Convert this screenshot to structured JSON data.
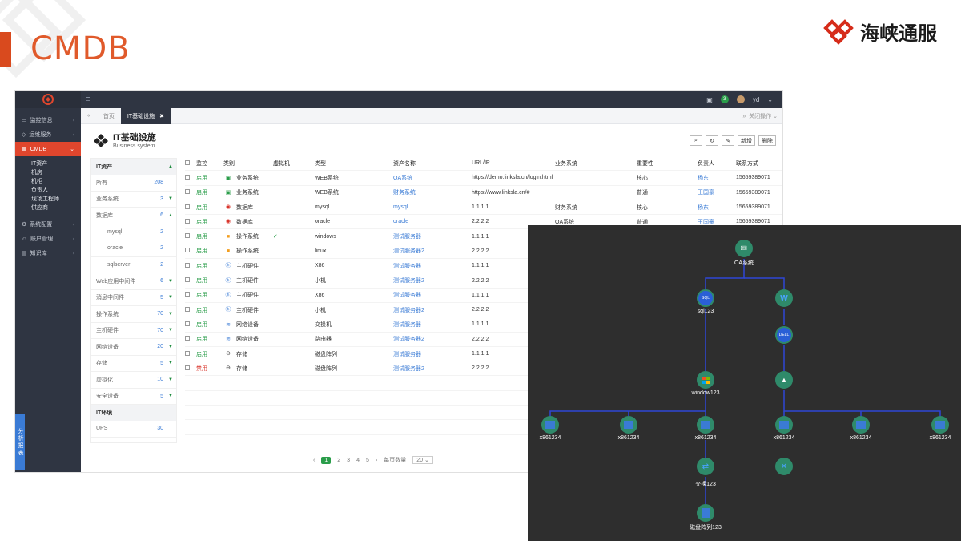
{
  "slide": {
    "title": "CMDB",
    "brand": "海峡通服",
    "colors": {
      "accent": "#e05a2b",
      "topo_bg": "#2e2e2e",
      "node": "#2f8a6a",
      "link": "#2f46d6"
    }
  },
  "app": {
    "topbar": {
      "user": "yd",
      "badge": "3"
    },
    "sidebar": {
      "items": [
        {
          "label": "监控信息",
          "icon": "monitor-icon"
        },
        {
          "label": "运维服务",
          "icon": "service-icon"
        },
        {
          "label": "CMDB",
          "icon": "grid-icon",
          "active": true
        },
        {
          "label": "系统配置",
          "icon": "gear-icon"
        },
        {
          "label": "账户管理",
          "icon": "user-icon"
        },
        {
          "label": "知识库",
          "icon": "book-icon"
        }
      ],
      "cmdb_sub": [
        "IT资产",
        "机房",
        "机柜",
        "负责人",
        "现场工程师",
        "供应商"
      ],
      "report": "分析报表"
    },
    "tabs": {
      "home": "首页",
      "current": "IT基础设施",
      "close_ops": "关闭操作"
    },
    "page": {
      "title": "IT基础设施",
      "subtitle": "Business system"
    },
    "toolbar": {
      "new": "新增",
      "delete": "删除"
    },
    "categories": {
      "head": "IT资产",
      "rows": [
        {
          "label": "所有",
          "count": "208"
        },
        {
          "label": "业务系统",
          "count": "3"
        },
        {
          "label": "数据库",
          "count": "6"
        },
        {
          "label": "mysql",
          "count": "2"
        },
        {
          "label": "oracle",
          "count": "2"
        },
        {
          "label": "sqlserver",
          "count": "2"
        },
        {
          "label": "Web应用中间件",
          "count": "6"
        },
        {
          "label": "消息中间件",
          "count": "5"
        },
        {
          "label": "操作系统",
          "count": "70"
        },
        {
          "label": "主机硬件",
          "count": "70"
        },
        {
          "label": "网络设备",
          "count": "20"
        },
        {
          "label": "存储",
          "count": "5"
        },
        {
          "label": "虚拟化",
          "count": "10"
        },
        {
          "label": "安全设备",
          "count": "5"
        }
      ],
      "env_head": "IT环境",
      "env_rows": [
        {
          "label": "UPS",
          "count": "30"
        }
      ]
    },
    "columns": [
      "监控",
      "类别",
      "虚拟机",
      "类型",
      "资产名称",
      "URL/IP",
      "业务系统",
      "重要性",
      "负责人",
      "联系方式"
    ],
    "rows": [
      {
        "status": "启用",
        "cat": "业务系统",
        "vm": "",
        "type": "WEB系统",
        "name": "OA系统",
        "url": "https://demo.linksla.cn/login.html",
        "biz": "",
        "imp": "核心",
        "owner": "杨东",
        "phone": "15659389071"
      },
      {
        "status": "启用",
        "cat": "业务系统",
        "vm": "",
        "type": "WEB系统",
        "name": "财务系统",
        "url": "https://www.linksla.cn/#",
        "biz": "",
        "imp": "普通",
        "owner": "王国豪",
        "phone": "15659389071"
      },
      {
        "status": "启用",
        "cat": "数据库",
        "vm": "",
        "type": "mysql",
        "name": "mysql",
        "url": "1.1.1.1",
        "biz": "财务系统",
        "imp": "核心",
        "owner": "杨东",
        "phone": "15659389071"
      },
      {
        "status": "启用",
        "cat": "数据库",
        "vm": "",
        "type": "oracle",
        "name": "oracle",
        "url": "2.2.2.2",
        "biz": "OA系统",
        "imp": "普通",
        "owner": "王国豪",
        "phone": "15659389071"
      },
      {
        "status": "启用",
        "cat": "操作系统",
        "vm": "✓",
        "type": "windows",
        "name": "测试服务器",
        "url": "1.1.1.1",
        "biz": "",
        "imp": "",
        "owner": "",
        "phone": ""
      },
      {
        "status": "启用",
        "cat": "操作系统",
        "vm": "",
        "type": "linux",
        "name": "测试服务器2",
        "url": "2.2.2.2",
        "biz": "",
        "imp": "",
        "owner": "",
        "phone": ""
      },
      {
        "status": "启用",
        "cat": "主机硬件",
        "vm": "",
        "type": "X86",
        "name": "测试服务器",
        "url": "1.1.1.1",
        "biz": "",
        "imp": "",
        "owner": "",
        "phone": ""
      },
      {
        "status": "启用",
        "cat": "主机硬件",
        "vm": "",
        "type": "小机",
        "name": "测试服务器2",
        "url": "2.2.2.2",
        "biz": "",
        "imp": "",
        "owner": "",
        "phone": ""
      },
      {
        "status": "启用",
        "cat": "主机硬件",
        "vm": "",
        "type": "X86",
        "name": "测试服务器",
        "url": "1.1.1.1",
        "biz": "",
        "imp": "",
        "owner": "",
        "phone": ""
      },
      {
        "status": "启用",
        "cat": "主机硬件",
        "vm": "",
        "type": "小机",
        "name": "测试服务器2",
        "url": "2.2.2.2",
        "biz": "",
        "imp": "",
        "owner": "",
        "phone": ""
      },
      {
        "status": "启用",
        "cat": "网络设备",
        "vm": "",
        "type": "交换机",
        "name": "测试服务器",
        "url": "1.1.1.1",
        "biz": "",
        "imp": "",
        "owner": "",
        "phone": ""
      },
      {
        "status": "启用",
        "cat": "网络设备",
        "vm": "",
        "type": "路由器",
        "name": "测试服务器2",
        "url": "2.2.2.2",
        "biz": "",
        "imp": "",
        "owner": "",
        "phone": ""
      },
      {
        "status": "启用",
        "cat": "存储",
        "vm": "",
        "type": "磁盘阵列",
        "name": "测试服务器",
        "url": "1.1.1.1",
        "biz": "",
        "imp": "",
        "owner": "",
        "phone": ""
      },
      {
        "status": "禁用",
        "cat": "存储",
        "vm": "",
        "type": "磁盘阵列",
        "name": "测试服务器2",
        "url": "2.2.2.2",
        "biz": "",
        "imp": "",
        "owner": "",
        "phone": ""
      }
    ],
    "pager": {
      "pages": [
        "1",
        "2",
        "3",
        "4",
        "5"
      ],
      "per_page_label": "每页数量",
      "per_page": "20"
    }
  },
  "topology": {
    "labels": {
      "oa": "OA系统",
      "sql": "sql123",
      "win": "window123",
      "x1": "x861234",
      "x2": "x861234",
      "x3": "x861234",
      "x4": "x861234",
      "x5": "x861234",
      "x6": "x861234",
      "sw": "交换123",
      "disk": "磁盘阵列123"
    }
  }
}
